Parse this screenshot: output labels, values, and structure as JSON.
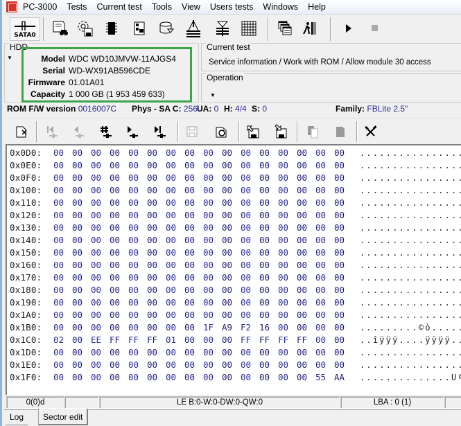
{
  "app": {
    "title": "PC-3000",
    "menu": [
      "Tests",
      "Current test",
      "Tools",
      "View",
      "Users tests",
      "Windows",
      "Help"
    ]
  },
  "toolbar": {
    "port_label": "SATA0",
    "buttons": [
      {
        "icon": "drive-info-icon",
        "label": "Drive information"
      },
      {
        "icon": "settings-disk-icon",
        "label": "Settings"
      },
      {
        "icon": "chip-icon",
        "label": "ROM"
      },
      {
        "icon": "board-icon",
        "label": "Board"
      },
      {
        "icon": "database-icon",
        "label": "Service area"
      },
      {
        "icon": "head-map-icon",
        "label": "Heads"
      },
      {
        "icon": "heads-stack-icon",
        "label": "Heads stack"
      },
      {
        "icon": "grid-icon",
        "label": "Sectors map"
      },
      {
        "icon": "windows-icon",
        "label": "Windows"
      },
      {
        "icon": "exit-icon",
        "label": "Exit"
      },
      {
        "icon": "play-icon",
        "label": "Start"
      },
      {
        "icon": "stop-icon",
        "label": "Stop"
      }
    ]
  },
  "hdd": {
    "group_title": "HDD",
    "fields": [
      {
        "key": "Model",
        "value": "WDC WD10JMVW-11AJGS4"
      },
      {
        "key": "Serial",
        "value": "WD-WX91AB596CDE"
      },
      {
        "key": "Firmware",
        "value": "01.01A01"
      },
      {
        "key": "Capacity",
        "value": "1 000 GB (1 953 459 633)"
      }
    ],
    "highlight_color": "#3aa54b"
  },
  "current_test": {
    "group_title": "Current test",
    "text": "Service information / Work with ROM / Allow module 30 access"
  },
  "operation": {
    "group_title": "Operation"
  },
  "info": {
    "rom_label": "ROM F/W version",
    "rom_value": "0016007C",
    "phys_label": "Phys - SA C:",
    "phys_value": "256",
    "ua_label": "UA:",
    "ua_value": "0",
    "h_label": "H:",
    "h_value": "4/4",
    "s_label": "S:",
    "s_value": "0",
    "family_label": "Family:",
    "family_value": "FBLite 2.5\""
  },
  "toolbar2": {
    "buttons": [
      {
        "icon": "close-document-icon",
        "enabled": true
      },
      {
        "icon": "first-sector-icon",
        "enabled": false
      },
      {
        "icon": "prev-sector-icon",
        "enabled": false
      },
      {
        "icon": "goto-sector-icon",
        "enabled": true
      },
      {
        "icon": "next-sector-icon",
        "enabled": true
      },
      {
        "icon": "last-sector-icon",
        "enabled": true
      },
      {
        "icon": "save-icon",
        "enabled": false
      },
      {
        "icon": "refresh-icon",
        "enabled": true
      },
      {
        "icon": "export-icon",
        "enabled": true
      },
      {
        "icon": "import-icon",
        "enabled": true
      },
      {
        "icon": "copy-icon",
        "enabled": false
      },
      {
        "icon": "paste-icon",
        "enabled": false
      },
      {
        "icon": "tools-icon",
        "enabled": true
      }
    ]
  },
  "hex": {
    "rows": [
      {
        "addr": "0x0D0:",
        "bytes": [
          "00",
          "00",
          "00",
          "00",
          "00",
          "00",
          "00",
          "00",
          "00",
          "00",
          "00",
          "00",
          "00",
          "00",
          "00",
          "00"
        ],
        "ascii": "................"
      },
      {
        "addr": "0x0E0:",
        "bytes": [
          "00",
          "00",
          "00",
          "00",
          "00",
          "00",
          "00",
          "00",
          "00",
          "00",
          "00",
          "00",
          "00",
          "00",
          "00",
          "00"
        ],
        "ascii": "................"
      },
      {
        "addr": "0x0F0:",
        "bytes": [
          "00",
          "00",
          "00",
          "00",
          "00",
          "00",
          "00",
          "00",
          "00",
          "00",
          "00",
          "00",
          "00",
          "00",
          "00",
          "00"
        ],
        "ascii": "................"
      },
      {
        "addr": "0x100:",
        "bytes": [
          "00",
          "00",
          "00",
          "00",
          "00",
          "00",
          "00",
          "00",
          "00",
          "00",
          "00",
          "00",
          "00",
          "00",
          "00",
          "00"
        ],
        "ascii": "................"
      },
      {
        "addr": "0x110:",
        "bytes": [
          "00",
          "00",
          "00",
          "00",
          "00",
          "00",
          "00",
          "00",
          "00",
          "00",
          "00",
          "00",
          "00",
          "00",
          "00",
          "00"
        ],
        "ascii": "................"
      },
      {
        "addr": "0x120:",
        "bytes": [
          "00",
          "00",
          "00",
          "00",
          "00",
          "00",
          "00",
          "00",
          "00",
          "00",
          "00",
          "00",
          "00",
          "00",
          "00",
          "00"
        ],
        "ascii": "................"
      },
      {
        "addr": "0x130:",
        "bytes": [
          "00",
          "00",
          "00",
          "00",
          "00",
          "00",
          "00",
          "00",
          "00",
          "00",
          "00",
          "00",
          "00",
          "00",
          "00",
          "00"
        ],
        "ascii": "................"
      },
      {
        "addr": "0x140:",
        "bytes": [
          "00",
          "00",
          "00",
          "00",
          "00",
          "00",
          "00",
          "00",
          "00",
          "00",
          "00",
          "00",
          "00",
          "00",
          "00",
          "00"
        ],
        "ascii": "................"
      },
      {
        "addr": "0x150:",
        "bytes": [
          "00",
          "00",
          "00",
          "00",
          "00",
          "00",
          "00",
          "00",
          "00",
          "00",
          "00",
          "00",
          "00",
          "00",
          "00",
          "00"
        ],
        "ascii": "................"
      },
      {
        "addr": "0x160:",
        "bytes": [
          "00",
          "00",
          "00",
          "00",
          "00",
          "00",
          "00",
          "00",
          "00",
          "00",
          "00",
          "00",
          "00",
          "00",
          "00",
          "00"
        ],
        "ascii": "................"
      },
      {
        "addr": "0x170:",
        "bytes": [
          "00",
          "00",
          "00",
          "00",
          "00",
          "00",
          "00",
          "00",
          "00",
          "00",
          "00",
          "00",
          "00",
          "00",
          "00",
          "00"
        ],
        "ascii": "................"
      },
      {
        "addr": "0x180:",
        "bytes": [
          "00",
          "00",
          "00",
          "00",
          "00",
          "00",
          "00",
          "00",
          "00",
          "00",
          "00",
          "00",
          "00",
          "00",
          "00",
          "00"
        ],
        "ascii": "................"
      },
      {
        "addr": "0x190:",
        "bytes": [
          "00",
          "00",
          "00",
          "00",
          "00",
          "00",
          "00",
          "00",
          "00",
          "00",
          "00",
          "00",
          "00",
          "00",
          "00",
          "00"
        ],
        "ascii": "................"
      },
      {
        "addr": "0x1A0:",
        "bytes": [
          "00",
          "00",
          "00",
          "00",
          "00",
          "00",
          "00",
          "00",
          "00",
          "00",
          "00",
          "00",
          "00",
          "00",
          "00",
          "00"
        ],
        "ascii": "................"
      },
      {
        "addr": "0x1B0:",
        "bytes": [
          "00",
          "00",
          "00",
          "00",
          "00",
          "00",
          "00",
          "00",
          "1F",
          "A9",
          "F2",
          "16",
          "00",
          "00",
          "00",
          "00"
        ],
        "ascii": ".........©ò....."
      },
      {
        "addr": "0x1C0:",
        "bytes": [
          "02",
          "00",
          "EE",
          "FF",
          "FF",
          "FF",
          "01",
          "00",
          "00",
          "00",
          "FF",
          "FF",
          "FF",
          "FF",
          "00",
          "00"
        ],
        "ascii": "..îÿÿÿ....ÿÿÿÿ.."
      },
      {
        "addr": "0x1D0:",
        "bytes": [
          "00",
          "00",
          "00",
          "00",
          "00",
          "00",
          "00",
          "00",
          "00",
          "00",
          "00",
          "00",
          "00",
          "00",
          "00",
          "00"
        ],
        "ascii": "................"
      },
      {
        "addr": "0x1E0:",
        "bytes": [
          "00",
          "00",
          "00",
          "00",
          "00",
          "00",
          "00",
          "00",
          "00",
          "00",
          "00",
          "00",
          "00",
          "00",
          "00",
          "00"
        ],
        "ascii": "................"
      },
      {
        "addr": "0x1F0:",
        "bytes": [
          "00",
          "00",
          "00",
          "00",
          "00",
          "00",
          "00",
          "00",
          "00",
          "00",
          "00",
          "00",
          "00",
          "00",
          "00",
          "55",
          "AA"
        ],
        "ascii": "..............Uª"
      }
    ]
  },
  "statusbar": {
    "offset": "0(0)d",
    "empty1": "",
    "endian": "LE B:0-W:0-DW:0-QW:0",
    "lba": "LBA : 0 (1)",
    "empty2": ""
  },
  "tabs": [
    {
      "label": "Log",
      "active": false
    },
    {
      "label": "Sector edit",
      "active": true
    }
  ]
}
